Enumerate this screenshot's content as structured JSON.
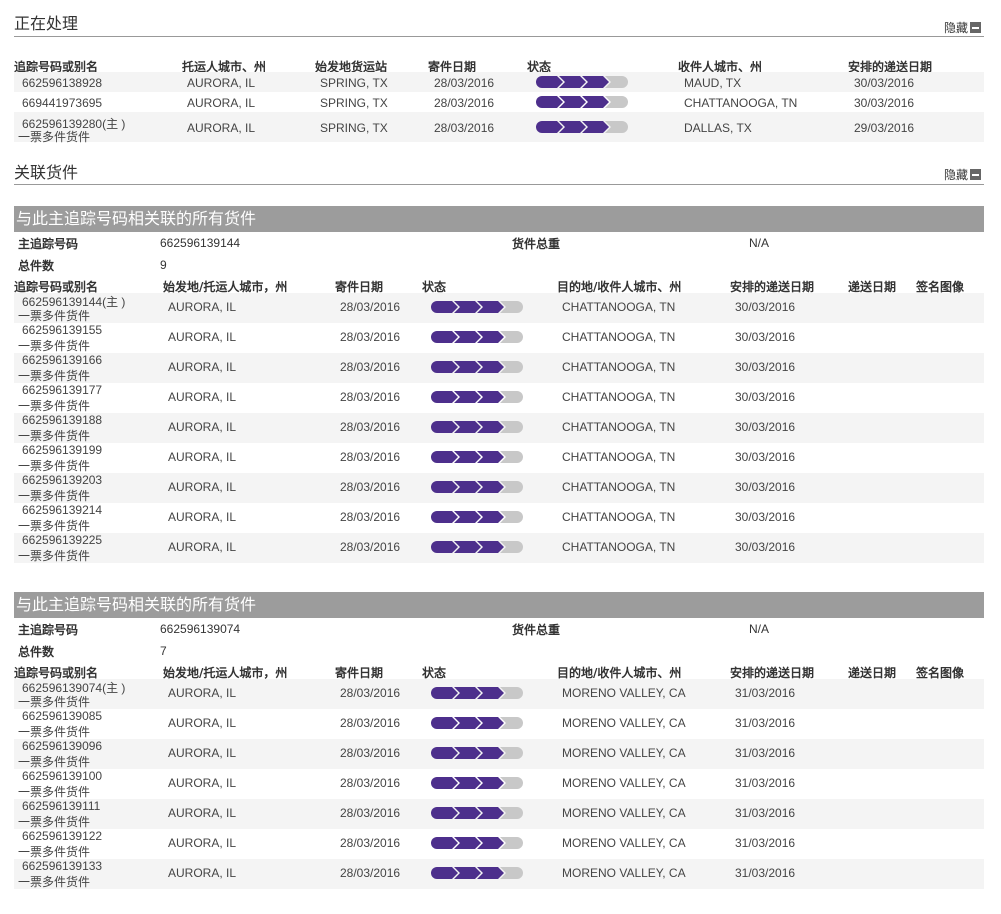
{
  "processing": {
    "title": "正在处理",
    "hide_label": "隐藏",
    "headers": [
      "追踪号码或别名",
      "托运人城市、州",
      "始发地货运站",
      "寄件日期",
      "状态",
      "收件人城市、州",
      "安排的递送日期"
    ],
    "rows": [
      {
        "tracking": "662596138928",
        "sub": "",
        "shipper": "AURORA, IL",
        "origin": "SPRING, TX",
        "ship_date": "28/03/2016",
        "progress": 0.75,
        "recipient": "MAUD, TX",
        "sched": "30/03/2016"
      },
      {
        "tracking": "669441973695",
        "sub": "",
        "shipper": "AURORA, IL",
        "origin": "SPRING, TX",
        "ship_date": "28/03/2016",
        "progress": 0.75,
        "recipient": "CHATTANOOGA, TN",
        "sched": "30/03/2016"
      },
      {
        "tracking": "662596139280(主 )",
        "sub": "一票多件货件",
        "shipper": "AURORA, IL",
        "origin": "SPRING, TX",
        "ship_date": "28/03/2016",
        "progress": 0.75,
        "recipient": "DALLAS, TX",
        "sched": "29/03/2016"
      }
    ]
  },
  "related": {
    "title": "关联货件",
    "hide_label": "隐藏"
  },
  "groups": [
    {
      "title": "与此主追踪号码相关联的所有货件",
      "master_label": "主追踪号码",
      "master_value": "662596139144",
      "weight_label": "货件总重",
      "weight_value": "N/A",
      "count_label": "总件数",
      "count_value": "9",
      "headers": [
        "追踪号码或别名",
        "始发地/托运人城市，州",
        "寄件日期",
        "状态",
        "目的地/收件人城市、州",
        "安排的递送日期",
        "递送日期",
        "签名图像"
      ],
      "rows": [
        {
          "tracking": "662596139144(主 )",
          "sub": "一票多件货件",
          "origin": "AURORA, IL",
          "ship_date": "28/03/2016",
          "progress": 0.75,
          "dest": "CHATTANOOGA, TN",
          "sched": "30/03/2016"
        },
        {
          "tracking": "662596139155",
          "sub": "一票多件货件",
          "origin": "AURORA, IL",
          "ship_date": "28/03/2016",
          "progress": 0.75,
          "dest": "CHATTANOOGA, TN",
          "sched": "30/03/2016"
        },
        {
          "tracking": "662596139166",
          "sub": "一票多件货件",
          "origin": "AURORA, IL",
          "ship_date": "28/03/2016",
          "progress": 0.75,
          "dest": "CHATTANOOGA, TN",
          "sched": "30/03/2016"
        },
        {
          "tracking": "662596139177",
          "sub": "一票多件货件",
          "origin": "AURORA, IL",
          "ship_date": "28/03/2016",
          "progress": 0.75,
          "dest": "CHATTANOOGA, TN",
          "sched": "30/03/2016"
        },
        {
          "tracking": "662596139188",
          "sub": "一票多件货件",
          "origin": "AURORA, IL",
          "ship_date": "28/03/2016",
          "progress": 0.75,
          "dest": "CHATTANOOGA, TN",
          "sched": "30/03/2016"
        },
        {
          "tracking": "662596139199",
          "sub": "一票多件货件",
          "origin": "AURORA, IL",
          "ship_date": "28/03/2016",
          "progress": 0.75,
          "dest": "CHATTANOOGA, TN",
          "sched": "30/03/2016"
        },
        {
          "tracking": "662596139203",
          "sub": "一票多件货件",
          "origin": "AURORA, IL",
          "ship_date": "28/03/2016",
          "progress": 0.75,
          "dest": "CHATTANOOGA, TN",
          "sched": "30/03/2016"
        },
        {
          "tracking": "662596139214",
          "sub": "一票多件货件",
          "origin": "AURORA, IL",
          "ship_date": "28/03/2016",
          "progress": 0.75,
          "dest": "CHATTANOOGA, TN",
          "sched": "30/03/2016"
        },
        {
          "tracking": "662596139225",
          "sub": "一票多件货件",
          "origin": "AURORA, IL",
          "ship_date": "28/03/2016",
          "progress": 0.75,
          "dest": "CHATTANOOGA, TN",
          "sched": "30/03/2016"
        }
      ]
    },
    {
      "title": "与此主追踪号码相关联的所有货件",
      "master_label": "主追踪号码",
      "master_value": "662596139074",
      "weight_label": "货件总重",
      "weight_value": "N/A",
      "count_label": "总件数",
      "count_value": "7",
      "headers": [
        "追踪号码或别名",
        "始发地/托运人城市，州",
        "寄件日期",
        "状态",
        "目的地/收件人城市、州",
        "安排的递送日期",
        "递送日期",
        "签名图像"
      ],
      "rows": [
        {
          "tracking": "662596139074(主 )",
          "sub": "一票多件货件",
          "origin": "AURORA, IL",
          "ship_date": "28/03/2016",
          "progress": 0.75,
          "dest": "MORENO VALLEY, CA",
          "sched": "31/03/2016"
        },
        {
          "tracking": "662596139085",
          "sub": "一票多件货件",
          "origin": "AURORA, IL",
          "ship_date": "28/03/2016",
          "progress": 0.75,
          "dest": "MORENO VALLEY, CA",
          "sched": "31/03/2016"
        },
        {
          "tracking": "662596139096",
          "sub": "一票多件货件",
          "origin": "AURORA, IL",
          "ship_date": "28/03/2016",
          "progress": 0.75,
          "dest": "MORENO VALLEY, CA",
          "sched": "31/03/2016"
        },
        {
          "tracking": "662596139100",
          "sub": "一票多件货件",
          "origin": "AURORA, IL",
          "ship_date": "28/03/2016",
          "progress": 0.75,
          "dest": "MORENO VALLEY, CA",
          "sched": "31/03/2016"
        },
        {
          "tracking": "662596139111",
          "sub": "一票多件货件",
          "origin": "AURORA, IL",
          "ship_date": "28/03/2016",
          "progress": 0.75,
          "dest": "MORENO VALLEY, CA",
          "sched": "31/03/2016"
        },
        {
          "tracking": "662596139122",
          "sub": "一票多件货件",
          "origin": "AURORA, IL",
          "ship_date": "28/03/2016",
          "progress": 0.75,
          "dest": "MORENO VALLEY, CA",
          "sched": "31/03/2016"
        },
        {
          "tracking": "662596139133",
          "sub": "一票多件货件",
          "origin": "AURORA, IL",
          "ship_date": "28/03/2016",
          "progress": 0.75,
          "dest": "MORENO VALLEY, CA",
          "sched": "31/03/2016"
        }
      ]
    }
  ],
  "colors": {
    "progress_filled": "#4d2f8c",
    "progress_empty": "#c8c8c8",
    "group_bar": "#9c9c9c"
  }
}
